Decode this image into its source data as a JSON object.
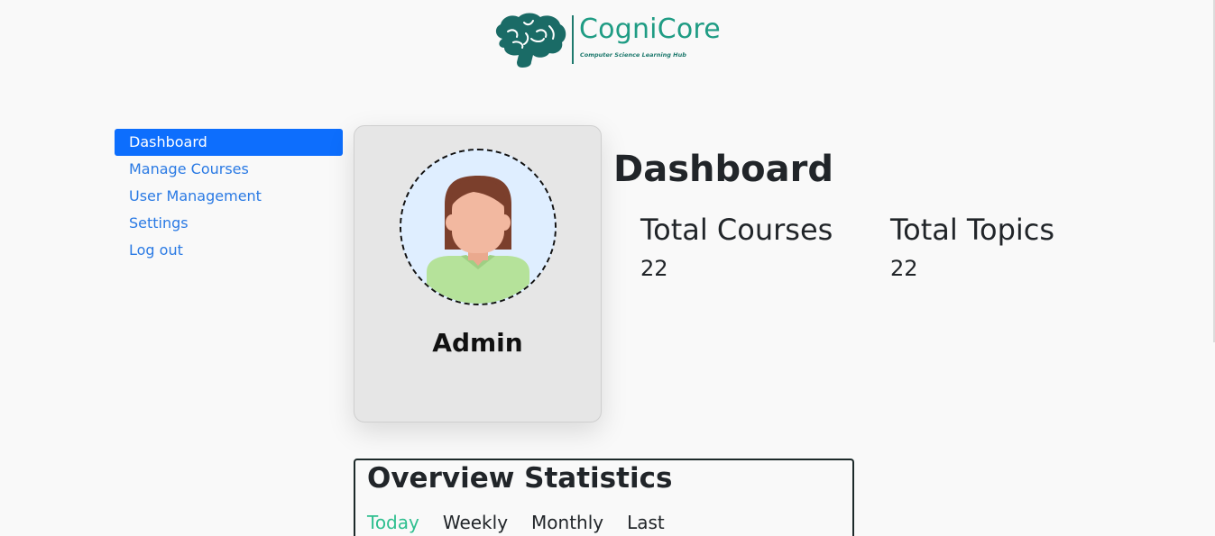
{
  "brand": {
    "name": "CogniCore",
    "tagline": "Computer Science Learning Hub",
    "color": "#1f9c84"
  },
  "sidebar": {
    "items": [
      {
        "label": "Dashboard",
        "active": true
      },
      {
        "label": "Manage Courses",
        "active": false
      },
      {
        "label": "User Management",
        "active": false
      },
      {
        "label": "Settings",
        "active": false
      },
      {
        "label": "Log out",
        "active": false
      }
    ]
  },
  "profile": {
    "name": "Admin",
    "avatar_icon": "female-user-avatar-icon"
  },
  "main": {
    "title": "Dashboard",
    "stats": [
      {
        "label": "Total Courses",
        "value": "22"
      },
      {
        "label": "Total Topics",
        "value": "22"
      }
    ]
  },
  "overview": {
    "title": "Overview Statistics",
    "tabs": [
      {
        "label": "Today",
        "active": true
      },
      {
        "label": "Weekly",
        "active": false
      },
      {
        "label": "Monthly",
        "active": false
      },
      {
        "label": "Last",
        "active": false
      }
    ]
  },
  "colors": {
    "accent": "#0d6efd",
    "link": "#2a7ae4",
    "active_tab": "#2fbf8f",
    "brand_dark": "#1f7a6e"
  }
}
